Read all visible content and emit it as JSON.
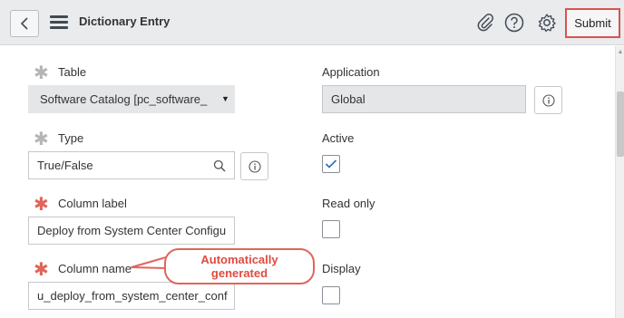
{
  "header": {
    "title": "Dictionary Entry",
    "submit_label": "Submit",
    "icons": [
      "back-icon",
      "menu-icon",
      "paperclip-icon",
      "help-icon",
      "gear-icon"
    ]
  },
  "form": {
    "table": {
      "label": "Table",
      "value": "Software Catalog [pc_software_"
    },
    "application": {
      "label": "Application",
      "value": "Global"
    },
    "type": {
      "label": "Type",
      "value": "True/False"
    },
    "active": {
      "label": "Active",
      "checked": true
    },
    "column_label": {
      "label": "Column label",
      "value": "Deploy from System Center Configu"
    },
    "read_only": {
      "label": "Read only",
      "checked": false
    },
    "column_name": {
      "label": "Column name",
      "value": "u_deploy_from_system_center_conf"
    },
    "display": {
      "label": "Display",
      "checked": false
    }
  },
  "callout": {
    "line1": "Automatically",
    "line2": "generated"
  },
  "colors": {
    "header_bg": "#e9ebed",
    "accent_red": "#d9534f",
    "required_red": "#e0655a",
    "check_blue": "#2e6bb5"
  }
}
